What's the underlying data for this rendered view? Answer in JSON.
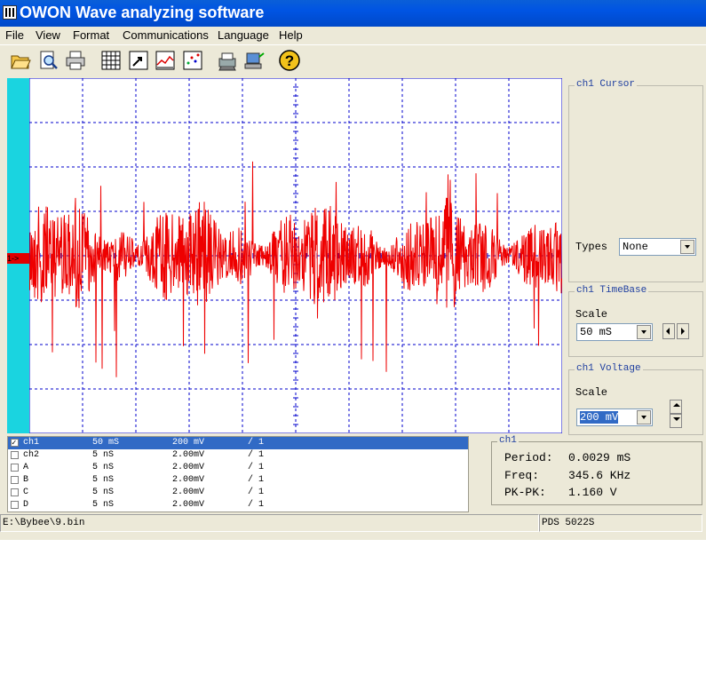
{
  "window": {
    "title": "OWON Wave analyzing software"
  },
  "menu": [
    "File",
    "View",
    "Format",
    "Communications",
    "Language",
    "Help"
  ],
  "toolbar": {
    "icons": [
      "open-folder-icon",
      "print-preview-icon",
      "printer-icon",
      "table-icon",
      "edit-export-icon",
      "chart-line-icon",
      "chart-scatter-icon",
      "device-print-icon",
      "device-connect-icon",
      "help-icon"
    ]
  },
  "scope": {
    "ch1_marker": "1->",
    "trace_color": "#ee0000",
    "grid_color": "#0000cc",
    "strip_color": "#1ad4e0"
  },
  "channels": [
    {
      "name": "ch1",
      "time": "50  mS",
      "volt": "200  mV",
      "ratio": "/ 1",
      "checked": true,
      "selected": true
    },
    {
      "name": "ch2",
      "time": "5  nS",
      "volt": "2.00mV",
      "ratio": "/ 1",
      "checked": false,
      "selected": false
    },
    {
      "name": "A",
      "time": "5  nS",
      "volt": "2.00mV",
      "ratio": "/ 1",
      "checked": false,
      "selected": false
    },
    {
      "name": "B",
      "time": "5  nS",
      "volt": "2.00mV",
      "ratio": "/ 1",
      "checked": false,
      "selected": false
    },
    {
      "name": "C",
      "time": "5  nS",
      "volt": "2.00mV",
      "ratio": "/ 1",
      "checked": false,
      "selected": false
    },
    {
      "name": "D",
      "time": "5  nS",
      "volt": "2.00mV",
      "ratio": "/ 1",
      "checked": false,
      "selected": false
    }
  ],
  "info": {
    "title": "ch1",
    "period_label": "Period:",
    "period_value": "0.0029 mS",
    "freq_label": "Freq:",
    "freq_value": "345.6 KHz",
    "pkpk_label": "PK-PK:",
    "pkpk_value": "1.160 V"
  },
  "cursor_panel": {
    "title": "ch1 Cursor",
    "types_label": "Types",
    "types_value": "None"
  },
  "timebase_panel": {
    "title": "ch1 TimeBase",
    "scale_label": "Scale",
    "scale_value": "50 mS"
  },
  "voltage_panel": {
    "title": "ch1 Voltage",
    "scale_label": "Scale",
    "scale_value": "200 mV"
  },
  "status": {
    "file_path": "E:\\Bybee\\9.bin",
    "device": "PDS 5022S"
  }
}
